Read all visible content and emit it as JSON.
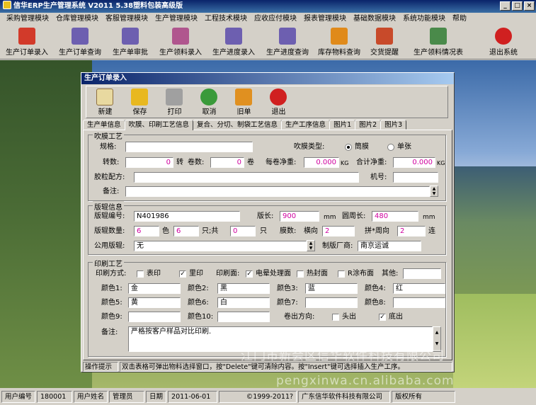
{
  "window": {
    "title": "信华ERP生产管理系统  V2011  5.38塑料包装高级版"
  },
  "menu": [
    "采购管理模块",
    "仓库管理模块",
    "客服管理模块",
    "生产管理模块",
    "工程技术模块",
    "应收应付模块",
    "报表管理模块",
    "基础数据模块",
    "系统功能模块",
    "帮助"
  ],
  "toolbar": [
    {
      "label": "生产订单录入",
      "icon": "pdf-red-icon",
      "color": "#d23a2a"
    },
    {
      "label": "生产订单查询",
      "icon": "form-edit-icon",
      "color": "#6d5fb0"
    },
    {
      "label": "生产单审批",
      "icon": "form-approve-icon",
      "color": "#6d5fb0"
    },
    {
      "label": "生产领料录入",
      "icon": "pick-material-icon",
      "color": "#b0568e"
    },
    {
      "label": "生产进度录入",
      "icon": "progress-input-icon",
      "color": "#6d5fb0"
    },
    {
      "label": "生产进度查询",
      "icon": "progress-query-icon",
      "color": "#6d5fb0"
    },
    {
      "label": "库存物料查询",
      "icon": "flower-icon",
      "color": "#e08a1a"
    },
    {
      "label": "交货提醒",
      "icon": "delivery-reminder-icon",
      "color": "#c84a2a"
    },
    {
      "label": "生产领料情况表",
      "icon": "pick-report-icon",
      "color": "#4a8a4a"
    },
    {
      "label": "退出系统",
      "icon": "exit-icon",
      "color": "#d02020"
    }
  ],
  "child": {
    "title": "生产订单录入",
    "buttons": [
      {
        "label": "新建",
        "icon": "new-document-icon",
        "color": "#e8d9a0"
      },
      {
        "label": "保存",
        "icon": "save-icon",
        "color": "#e8b820"
      },
      {
        "label": "打印",
        "icon": "printer-icon",
        "color": "#a0a0a0"
      },
      {
        "label": "取消",
        "icon": "cancel-icon",
        "color": "#3a9a3a"
      },
      {
        "label": "旧单",
        "icon": "old-order-icon",
        "color": "#e09020"
      },
      {
        "label": "退出",
        "icon": "exit-icon",
        "color": "#d02020"
      }
    ],
    "tabs": [
      "生产单信息",
      "吹膜、印刷工艺信息",
      "复合、分切、制袋工艺信息",
      "生产工序信息",
      "图片1",
      "图片2",
      "图片3"
    ],
    "active_tab": 1
  },
  "blow": {
    "title": "吹膜工艺",
    "spec_label": "规格:",
    "spec": "",
    "type_label": "吹膜类型:",
    "type_options": [
      "筒膜",
      "单张"
    ],
    "type_selected": "筒膜",
    "turns_label": "转数:",
    "turns": "0",
    "turns_unit": "转",
    "rolls_label": "卷数:",
    "rolls": "0",
    "rolls_unit": "卷",
    "net_label": "每卷净重:",
    "net": "0.000",
    "net_unit": "KG",
    "total_label": "合计净重:",
    "total": "0.000",
    "total_unit": "KG",
    "pellet_label": "胶粒配方:",
    "pellet": "",
    "machine_label": "机号:",
    "machine": "",
    "note_label": "备注:",
    "note": ""
  },
  "plate": {
    "title": "版辊信息",
    "no_label": "版辊编号:",
    "no": "N401986",
    "len_label": "版长:",
    "len": "900",
    "len_unit": "mm",
    "circ_label": "圆周长:",
    "circ": "480",
    "circ_unit": "mm",
    "qty_label": "版辊数量:",
    "qty": "6",
    "color_unit": "色",
    "qty2": "6",
    "total_unit": "只;共",
    "qty3": "0",
    "piece_unit": "只",
    "count_label": "膜数:",
    "horiz_label": "横向",
    "horiz": "2",
    "circum_label": "拼*周向",
    "circum": "2",
    "link_unit": "连",
    "public_label": "公用版辊:",
    "public": "无",
    "maker_label": "制版厂商:",
    "maker": "南京运诚"
  },
  "print": {
    "title": "印刷工艺",
    "method_label": "印刷方式:",
    "surface_label": "表印",
    "surface_checked": false,
    "inside_label": "里印",
    "inside_checked": true,
    "face_label": "印刷面:",
    "corona_label": "电晕处理面",
    "corona_checked": true,
    "heat_label": "热封面",
    "heat_checked": false,
    "coat_label": "R涂布面",
    "coat_checked": false,
    "other_label": "其他:",
    "other": "",
    "colors": [
      {
        "label": "颜色1:",
        "value": "金"
      },
      {
        "label": "颜色2:",
        "value": "黑"
      },
      {
        "label": "颜色3:",
        "value": "蓝"
      },
      {
        "label": "颜色4:",
        "value": "红"
      },
      {
        "label": "颜色5:",
        "value": "黄"
      },
      {
        "label": "颜色6:",
        "value": "白"
      },
      {
        "label": "颜色7:",
        "value": ""
      },
      {
        "label": "颜色8:",
        "value": ""
      },
      {
        "label": "颜色9:",
        "value": ""
      },
      {
        "label": "颜色10:",
        "value": ""
      }
    ],
    "dir_label": "卷出方向:",
    "head_label": "头出",
    "head_checked": false,
    "bottom_label": "底出",
    "bottom_checked": true,
    "note_label": "备注:",
    "note": "严格按客户样品对比印刷."
  },
  "hint": {
    "label": "操作提示",
    "text": "双击表格可弹出物料选择窗口，按\"Delete\"键可清除内容。按\"Insert\"键可选择插入生产工序。"
  },
  "status": {
    "user_no_label": "用户编号",
    "user_no": "180001",
    "user_name_label": "用户姓名",
    "user_name": "管理员",
    "date_label": "日期",
    "date": "2011-06-01",
    "copyright": "©1999-2011?",
    "company": "广东信华软件科技有限公司",
    "rights": "版权所有"
  },
  "watermark": {
    "line1": "江门市新会区信华软件科技有限公司",
    "line2": "pengxinwa.cn.alibaba.com"
  }
}
